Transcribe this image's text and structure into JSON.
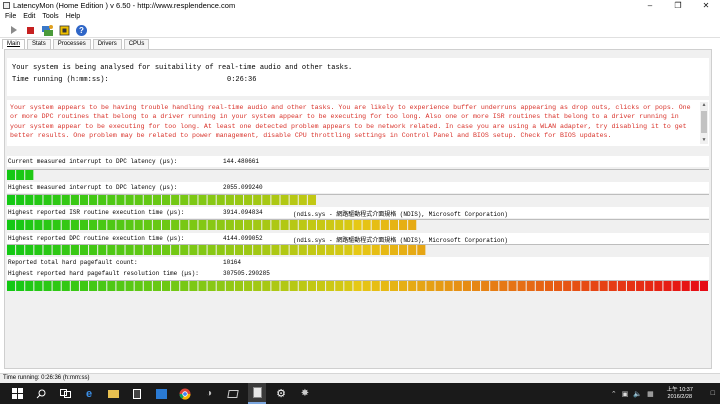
{
  "window": {
    "title": "LatencyMon  (Home Edition )  v 6.50 - http://www.resplendence.com",
    "controls": [
      "–",
      "❐",
      "✕"
    ]
  },
  "menu": [
    "File",
    "Edit",
    "Tools",
    "Help"
  ],
  "toolbar": {
    "icons": [
      "play-icon",
      "stop-icon",
      "drivers-icon",
      "cpu-icon",
      "help-icon"
    ]
  },
  "tabs": [
    "Main",
    "Stats",
    "Processes",
    "Drivers",
    "CPUs"
  ],
  "active_tab": "Main",
  "status": {
    "message": "Your system is being analysed for suitability of real-time audio and other tasks.",
    "time_label": "Time running (h:mm:ss):",
    "time_value": "0:26:36"
  },
  "conclusion": "Your system appears to be having trouble handling real-time audio and other tasks. You are likely to experience buffer underruns appearing as drop outs, clicks or pops. One or more DPC routines that belong to a driver running in your system appear to be executing for too long. Also one or more ISR routines that belong to a driver running in your system appear to be executing for too long. At least one detected problem appears to be network related. In case you are using a WLAN adapter, try disabling it to get better results. One problem may be related to power management, disable CPU throttling settings in Control Panel and BIOS setup. Check for BIOS updates.",
  "metrics": {
    "current_interrupt": {
      "label": "Current measured interrupt to DPC latency (µs):",
      "value": "144.480661",
      "level": 0.037
    },
    "highest_interrupt": {
      "label": "Highest measured interrupt to DPC latency (µs):",
      "value": "2055.099240",
      "level": 0.448
    },
    "highest_isr": {
      "label": "Highest reported ISR routine execution time (µs):",
      "value": "3914.094834",
      "desc": "(ndis.sys - 網路驅動程式介面規格 (NDIS), Microsoft Corporation)",
      "level": 0.586
    },
    "highest_dpc": {
      "label": "Highest reported DPC routine execution time (µs):",
      "value": "4144.099052",
      "desc": "(ndis.sys - 網路驅動程式介面規格 (NDIS), Microsoft Corporation)",
      "level": 0.6
    },
    "pagefault_count": {
      "label": "Reported total hard pagefault count:",
      "value": "10164"
    },
    "pagefault_resolution": {
      "label": "Highest reported hard pagefault resolution time (µs):",
      "value": "307505.290285",
      "level": 1.0
    }
  },
  "statusbar": "Time running: 0:26:36  (h:mm:ss)",
  "colors": {
    "conclusion_text": "#d8322a",
    "taskbar": "#1a1a1a"
  },
  "taskbar": {
    "apps": [
      "windows-start-icon",
      "search-icon",
      "task-view-icon",
      "edge-icon",
      "file-explorer-icon",
      "calculator-icon",
      "store-icon",
      "chrome-icon",
      "shield-app-icon",
      "tablet-app-icon",
      "latencymon-icon",
      "settings-gear-icon",
      "cleaner-app-icon"
    ],
    "time": "上午 10:37",
    "date": "2016/2/28"
  }
}
